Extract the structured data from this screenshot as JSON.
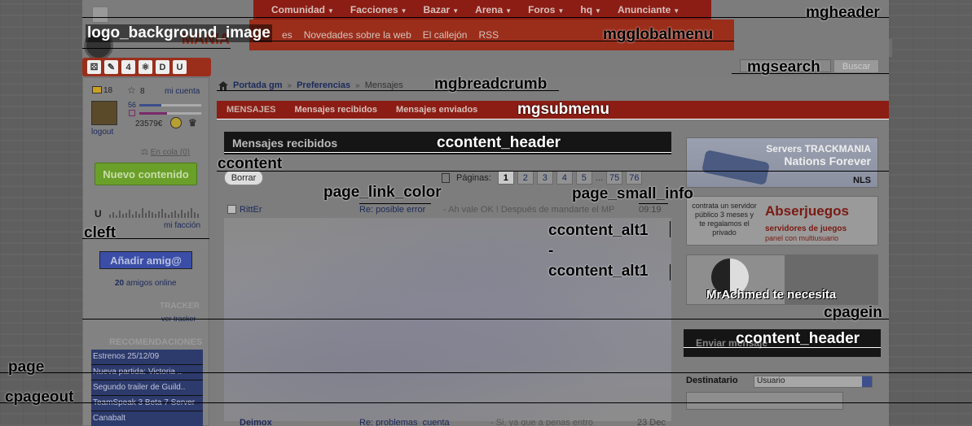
{
  "topnav": {
    "items": [
      "Comunidad",
      "Facciones",
      "Bazar",
      "Arena",
      "Foros",
      "hq",
      "Anunciante"
    ]
  },
  "globalmenu": {
    "items": [
      "es",
      "Novedades sobre la web",
      "El callejón",
      "RSS"
    ]
  },
  "logo": {
    "text": "MANIA"
  },
  "iconrow": {
    "items": [
      "⚄",
      "✎",
      "4",
      "⚛",
      "D",
      "U"
    ]
  },
  "search": {
    "button": "Buscar"
  },
  "breadcrumb": {
    "home": "Portada gm",
    "section": "Preferencias",
    "current": "Mensajes"
  },
  "submenu": {
    "items": [
      "MENSAJES",
      "Mensajes recibidos",
      "Mensajes enviados"
    ]
  },
  "content": {
    "header": "Mensajes recibidos",
    "delete_button": "Borrar",
    "pages_label": "Páginas:",
    "pages": [
      "1",
      "2",
      "3",
      "4",
      "5",
      "...",
      "75",
      "76"
    ],
    "current_page": "1",
    "messages": [
      {
        "user": "RittEr",
        "subject": "Re: posible error",
        "preview": "- Ah vale OK ! Después de mandarte el MP",
        "time": "09:19"
      },
      {
        "user": "Deimox",
        "subject": "Re: problemas_cuenta",
        "preview": "- Si, ya que a penas entro",
        "time": "23 Dec"
      }
    ]
  },
  "sidebar": {
    "mail_count": "18",
    "star_count": "8",
    "account_link": "mi cuenta",
    "level": "56",
    "level_progress": 0.35,
    "karma_progress": 0.45,
    "credits": "23579€",
    "logout": "logout",
    "queue": "En cola (0)",
    "new_content_button": "Nuevo contenido",
    "faction_link": "mi facción",
    "add_friend_button": "Añadir amig@",
    "friends_count": "20",
    "friends_online_label": "amigos online",
    "tracker_title": "TRACKER",
    "tracker_link": "ver tracker",
    "recommendations_title": "RECOMENDACIONES",
    "recommendations": [
      "Estrenos 25/12/09",
      "Nueva partida: Victoria ..",
      "Segundo trailer de Guild..",
      "TeamSpeak 3 Beta 7 Server",
      "Canabalt"
    ]
  },
  "ads": {
    "ad1": {
      "line1": "Servers TRACKMANIA",
      "line2": "Nations Forever",
      "brand": "NLS"
    },
    "ad2": {
      "left": "contrata un servidor público 3 meses y te regalamos el privado",
      "logo": "Abserjuegos",
      "sub1": "servidores de juegos",
      "sub2": "panel con multiusuario"
    },
    "ad3": {
      "text": "MrAchmed te necesita"
    }
  },
  "sendmsg": {
    "header": "Enviar mensaje",
    "dest_label": "Destinatario",
    "dest_select": "Usuario"
  },
  "annotations": {
    "mgheader": "mgheader",
    "logo_bg": "logo_background_image",
    "mgglobalmenu": "mgglobalmenu",
    "mgsearch": "mgsearch",
    "mgbreadcrumb": "mgbreadcrumb",
    "mgsubmenu": "mgsubmenu",
    "ccontent_header": "ccontent_header",
    "ccontent": "ccontent",
    "page_link_color": "page_link_color",
    "page_small_info": "page_small_info",
    "ccontent_alt1": "ccontent_alt1",
    "dash": "-",
    "ccontent_alt1b": "ccontent_alt1",
    "cleft": "cleft",
    "cpagein": "cpagein",
    "ccontent_header2": "ccontent_header",
    "page": "page",
    "cpageout": "cpageout"
  }
}
